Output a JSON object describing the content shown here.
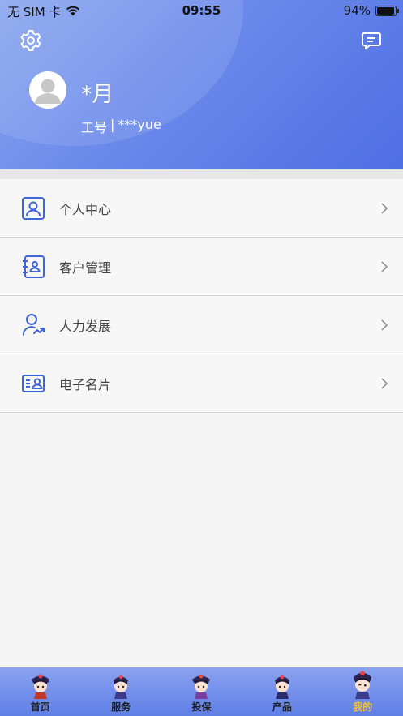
{
  "status_bar": {
    "carrier": "无 SIM 卡",
    "time": "09:55",
    "battery": "94%",
    "battery_level": 0.94
  },
  "header": {
    "user_name": "*月",
    "employee_id_label": "工号",
    "separator": "|",
    "employee_id_value": "***yue",
    "settings_icon": "gear-icon",
    "message_icon": "message-icon"
  },
  "menu": {
    "items": [
      {
        "label": "个人中心",
        "icon": "person-card-icon"
      },
      {
        "label": "客户管理",
        "icon": "contact-book-icon"
      },
      {
        "label": "人力发展",
        "icon": "person-growth-icon"
      },
      {
        "label": "电子名片",
        "icon": "business-card-icon"
      }
    ]
  },
  "tabbar": {
    "tabs": [
      {
        "label": "首页",
        "icon": "mascot-icon"
      },
      {
        "label": "服务",
        "icon": "mascot-icon"
      },
      {
        "label": "投保",
        "icon": "mascot-icon"
      },
      {
        "label": "产品",
        "icon": "mascot-icon"
      },
      {
        "label": "我的",
        "icon": "mascot-icon"
      }
    ],
    "active_index": 4
  },
  "colors": {
    "accent": "#4f6ee4",
    "icon_blue": "#3f63d8",
    "active_tab": "#f3c13a"
  }
}
